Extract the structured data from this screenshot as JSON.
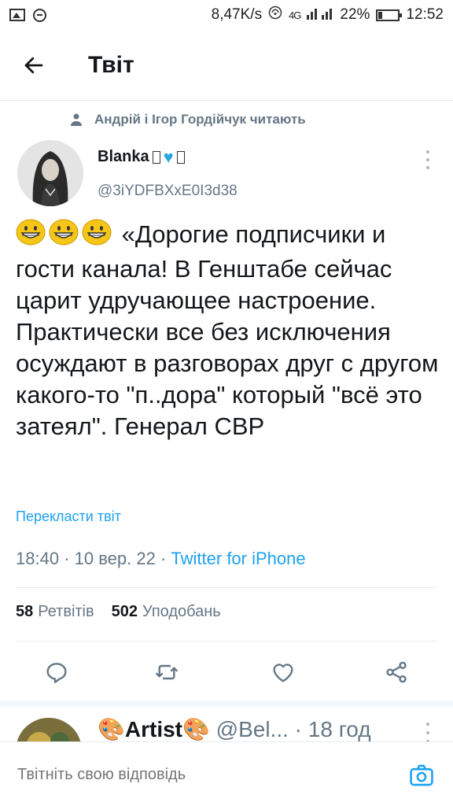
{
  "status_bar": {
    "speed": "8,47K/s",
    "network": "4G",
    "battery": "22%",
    "time": "12:52"
  },
  "header": {
    "title": "Твіт"
  },
  "social_context": "Андрій і Ігор Гордійчук читають",
  "tweet": {
    "author_name": "Blanka",
    "author_handle": "@3iYDFBXxE0I3d38",
    "text": "«Дорогие подписчики и гости канала! В Генштабе сейчас царит удручающее настроение. Практически все без исключения осуждают в разговорах друг с другом какого-то \"п..дора\" который \"всё это затеял\".  Генерал СВР",
    "translate_label": "Перекласти твіт",
    "time": "18:40",
    "date": "10 вер. 22",
    "client": "Twitter for iPhone",
    "retweets_count": "58",
    "retweets_label": "Ретвітів",
    "likes_count": "502",
    "likes_label": "Уподобань"
  },
  "reply_preview": {
    "name": "Artist",
    "handle": "@Bel...",
    "time": "· 18 год"
  },
  "composer": {
    "placeholder": "Твітніть свою відповідь"
  },
  "icons": {
    "back": "arrow-left-icon",
    "more": "more-vertical-icon",
    "reply": "reply-icon",
    "retweet": "retweet-icon",
    "like": "heart-icon",
    "share": "share-icon",
    "camera": "camera-icon"
  },
  "colors": {
    "accent": "#1da1f2",
    "secondary_text": "#657786",
    "primary_text": "#14171a"
  }
}
